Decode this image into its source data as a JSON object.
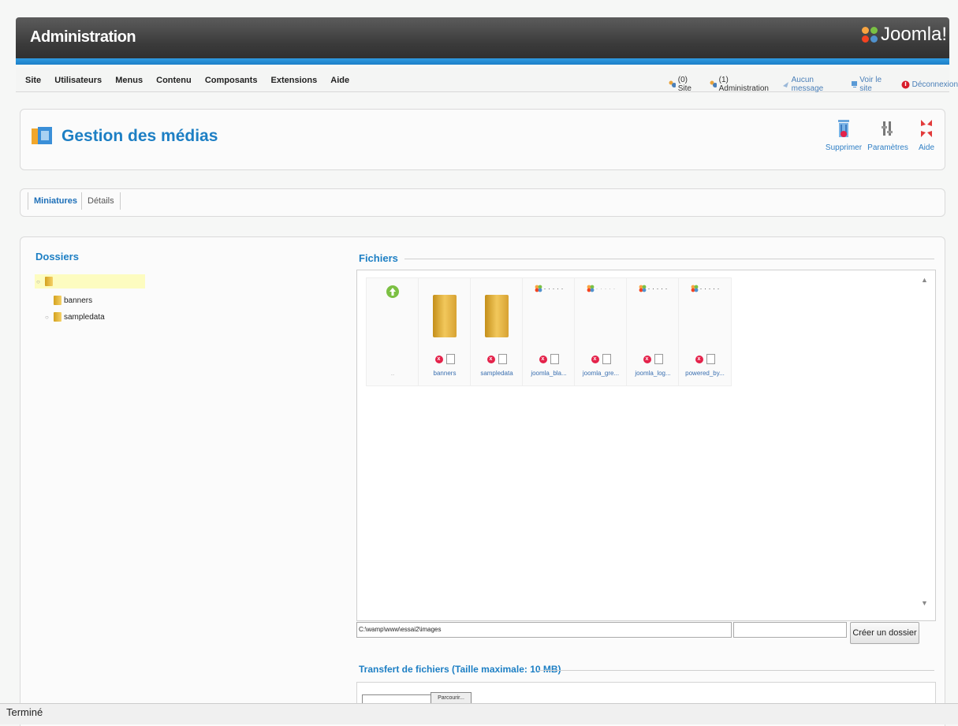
{
  "header": {
    "title": "Administration",
    "logo_text": "Joomla!"
  },
  "menu": {
    "items": [
      "Site",
      "Utilisateurs",
      "Menus",
      "Contenu",
      "Composants",
      "Extensions",
      "Aide"
    ],
    "status": {
      "site": "(0) Site",
      "admin": "(1) Administration",
      "messages": "Aucun message",
      "view_site": "Voir le site",
      "logout": "Déconnexion"
    }
  },
  "page": {
    "title": "Gestion des médias"
  },
  "toolbar": {
    "delete": "Supprimer",
    "params": "Paramètres",
    "help": "Aide"
  },
  "tabs": {
    "thumbnails": "Miniatures",
    "details": "Détails"
  },
  "folders": {
    "title": "Dossiers",
    "root": "",
    "children": [
      "banners",
      "sampledata"
    ]
  },
  "files": {
    "title": "Fichiers",
    "items": [
      {
        "label": "banners",
        "kind": "folder"
      },
      {
        "label": "sampledata",
        "kind": "folder"
      },
      {
        "label": "joomla_bla...",
        "kind": "image"
      },
      {
        "label": "joomla_gre...",
        "kind": "image"
      },
      {
        "label": "joomla_log...",
        "kind": "image"
      },
      {
        "label": "powered_by...",
        "kind": "image"
      }
    ],
    "path": "C:\\wamp\\www\\essai2\\images",
    "create_folder": "Créer un dossier"
  },
  "upload": {
    "title": "Transfert de fichiers (Taille maximale: 10 MB)",
    "browse": "Parcourir..."
  },
  "status_bar": {
    "text": "Terminé"
  },
  "colors": {
    "accent": "#1d7fc4",
    "header": "#3b3b3b",
    "header_bar": "#1c7fc7"
  }
}
